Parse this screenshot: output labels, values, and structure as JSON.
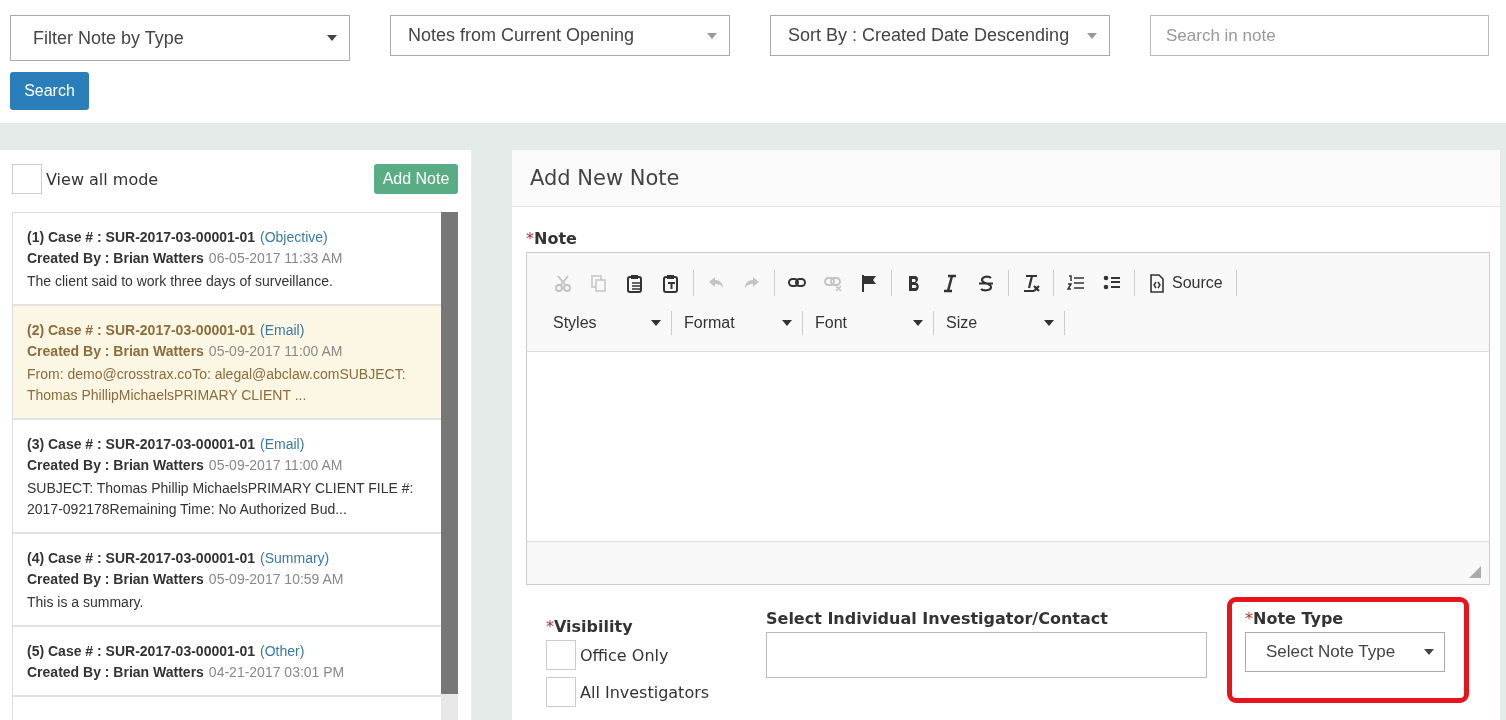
{
  "filters": {
    "type_filter": "Filter Note by Type",
    "source_filter": "Notes from Current Opening",
    "sort": "Sort By : Created Date Descending",
    "search": {
      "placeholder": "Search in note"
    },
    "search_button": "Search"
  },
  "notes_panel": {
    "view_all": {
      "label": "View all mode",
      "checked": false
    },
    "add_button": "Add Note",
    "notes": [
      {
        "title": "(1) Case # : SUR-2017-03-00001-01",
        "type": "(Objective)",
        "author": "Created By : Brian Watters",
        "date": "06-05-2017 11:33 AM",
        "text": "The client said to work three days of surveillance.",
        "selected": false
      },
      {
        "title": "(2) Case # : SUR-2017-03-00001-01",
        "type": "(Email)",
        "author": "Created By : Brian Watters",
        "date": "05-09-2017 11:00 AM",
        "text": "From: demo@crosstrax.coTo: alegal@abclaw.comSUBJECT: Thomas PhillipMichaelsPRIMARY CLIENT ...",
        "selected": true
      },
      {
        "title": "(3) Case # : SUR-2017-03-00001-01",
        "type": "(Email)",
        "author": "Created By : Brian Watters",
        "date": "05-09-2017 11:00 AM",
        "text": "SUBJECT: Thomas Phillip MichaelsPRIMARY CLIENT FILE #: 2017-092178Remaining Time: No Authorized Bud...",
        "selected": false
      },
      {
        "title": "(4) Case # : SUR-2017-03-00001-01",
        "type": "(Summary)",
        "author": "Created By : Brian Watters",
        "date": "05-09-2017 10:59 AM",
        "text": "This is a summary.",
        "selected": false
      },
      {
        "title": "(5) Case # : SUR-2017-03-00001-01",
        "type": "(Other)",
        "author": "Created By : Brian Watters",
        "date": "04-21-2017 03:01 PM",
        "selected": false
      }
    ]
  },
  "add_note": {
    "title": "Add New Note",
    "note_label": "Note",
    "required_mark": "*",
    "toolbar": [
      [
        {
          "kind": "cut",
          "disabled": true
        },
        {
          "kind": "copy",
          "disabled": true
        },
        {
          "kind": "paste",
          "disabled": false
        },
        {
          "kind": "paste-text",
          "disabled": false
        }
      ],
      [
        {
          "kind": "undo",
          "disabled": true
        },
        {
          "kind": "redo",
          "disabled": true
        }
      ],
      [
        {
          "kind": "link",
          "disabled": false
        },
        {
          "kind": "unlink",
          "disabled": true
        },
        {
          "kind": "anchor",
          "disabled": false
        }
      ],
      [
        {
          "kind": "bold",
          "disabled": false
        },
        {
          "kind": "italic",
          "disabled": false
        },
        {
          "kind": "strike",
          "disabled": false
        }
      ],
      [
        {
          "kind": "clear-format",
          "disabled": false
        }
      ],
      [
        {
          "kind": "numbered-list",
          "disabled": false
        },
        {
          "kind": "bulleted-list",
          "disabled": false
        }
      ],
      [
        {
          "kind": "source",
          "label": "Source",
          "disabled": false
        }
      ]
    ],
    "combos": [
      "Styles",
      "Format",
      "Font",
      "Size"
    ],
    "visibility": {
      "label": "Visibility",
      "required_mark": "*",
      "options": [
        {
          "label": "Office Only",
          "checked": false
        },
        {
          "label": "All Investigators",
          "checked": false
        }
      ]
    },
    "investigator": {
      "label": "Select Individual Investigator/Contact"
    },
    "note_type": {
      "label": "Note Type",
      "required_mark": "*",
      "value": "Select Note Type",
      "highlighted": true
    }
  }
}
